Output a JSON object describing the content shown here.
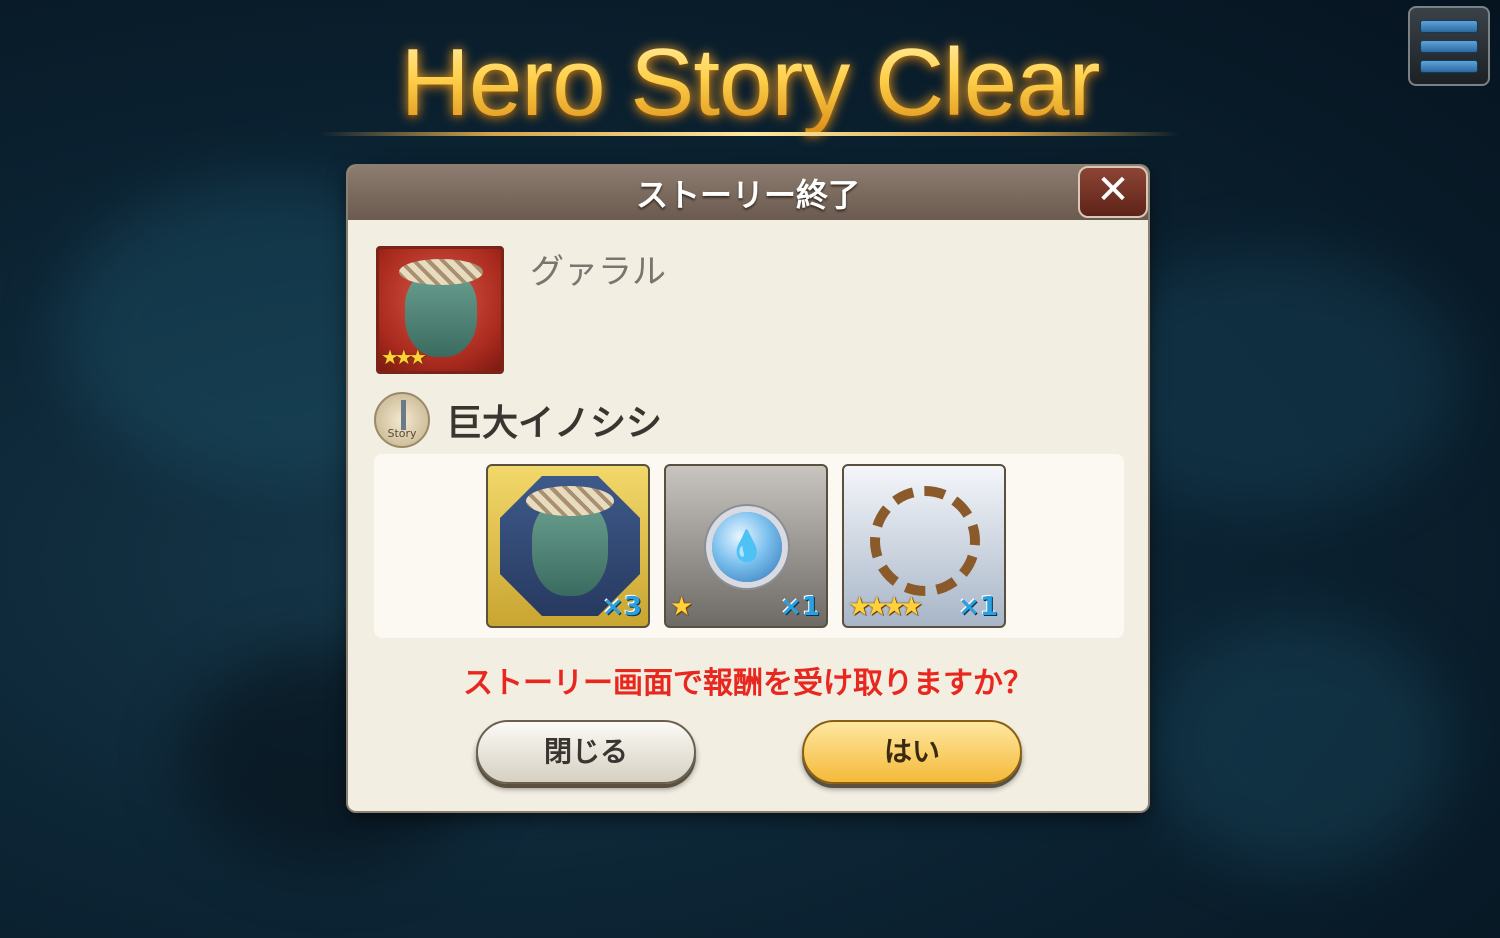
{
  "banner": {
    "title": "Hero Story Clear"
  },
  "menu": {
    "icon": "hamburger-menu-icon"
  },
  "dialog": {
    "title": "ストーリー終了",
    "close_glyph": "✕",
    "hero": {
      "name": "グァラル",
      "rarity_stars": "★★★",
      "rarity": 3
    },
    "story": {
      "icon_label": "Story",
      "chapter_title": "巨大イノシシ"
    },
    "rewards": [
      {
        "type": "hero-fragment",
        "icon": "orc-hero-portrait-icon",
        "stars": "",
        "quantity": "×3"
      },
      {
        "type": "item",
        "icon": "water-orb-icon",
        "stars": "★",
        "quantity": "×1"
      },
      {
        "type": "equipment",
        "icon": "rope-icon",
        "stars": "★★★★",
        "quantity": "×1"
      }
    ],
    "prompt": "ストーリー画面で報酬を受け取りますか？",
    "buttons": {
      "close": "閉じる",
      "yes": "はい"
    }
  },
  "colors": {
    "prompt": "#e8281e",
    "yes_button": "#f4ba3a",
    "header": "#7a6a5e"
  }
}
